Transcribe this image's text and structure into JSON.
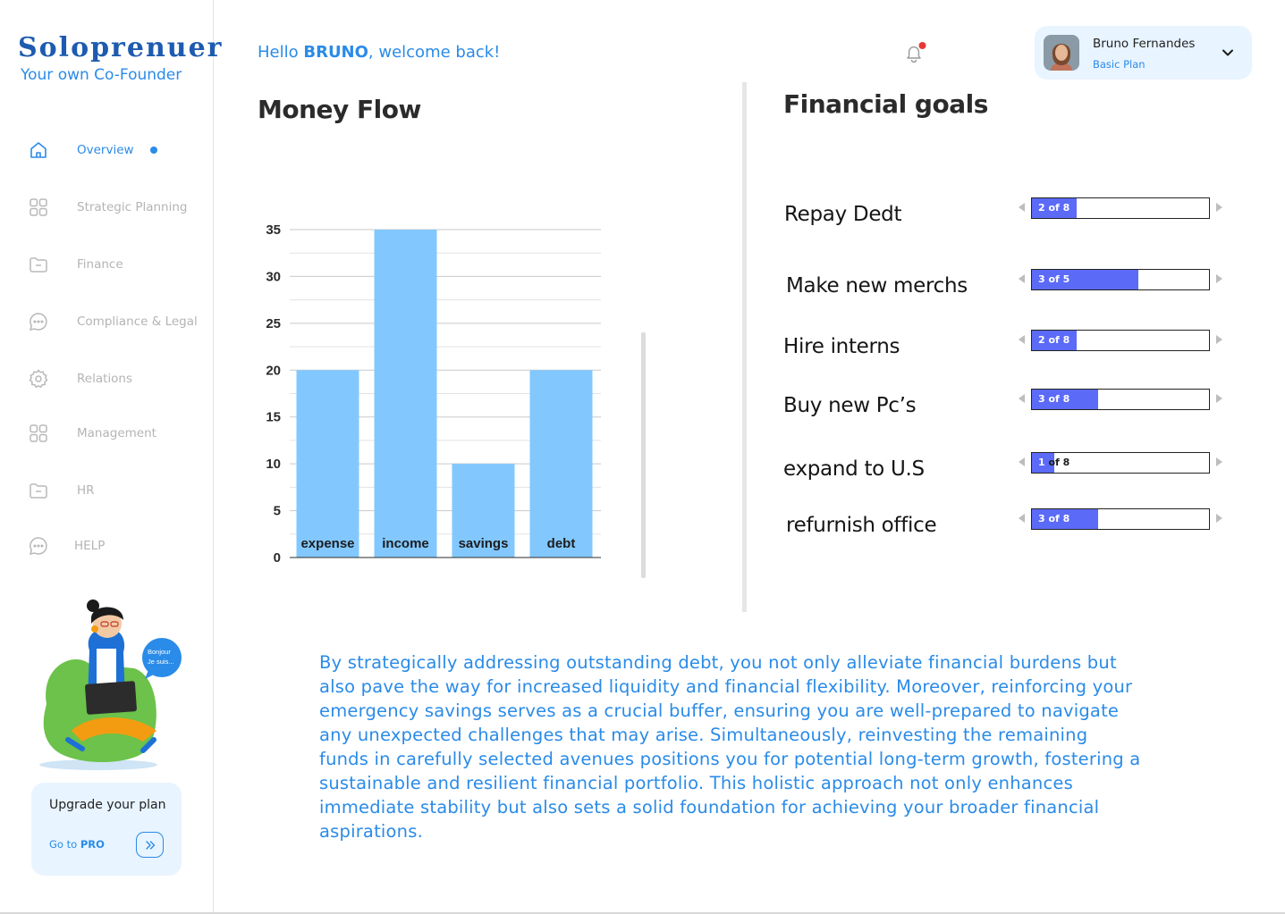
{
  "brand": {
    "name": "Soloprenuer",
    "tagline": "Your own Co-Founder"
  },
  "nav": [
    {
      "label": "Overview",
      "icon": "home-icon",
      "active": true
    },
    {
      "label": "Strategic Planning",
      "icon": "grid-icon"
    },
    {
      "label": "Finance",
      "icon": "folder-icon"
    },
    {
      "label": "Compliance & Legal",
      "icon": "chat-icon"
    },
    {
      "label": "Relations",
      "icon": "gear-icon"
    },
    {
      "label": "Management",
      "icon": "grid-icon"
    },
    {
      "label": "HR",
      "icon": "folder-icon"
    },
    {
      "label": "HELP",
      "icon": "chat-icon"
    }
  ],
  "illustration": {
    "speech": "Bonjour Je suis..."
  },
  "upgrade": {
    "title": "Upgrade your plan",
    "link_prefix": "Go to ",
    "link_bold": "PRO"
  },
  "header": {
    "greeting_prefix": "Hello ",
    "greeting_name": "BRUNO",
    "greeting_suffix": ", welcome back!"
  },
  "profile": {
    "name": "Bruno Fernandes",
    "plan": "Basic Plan"
  },
  "money_flow": {
    "title": "Money Flow"
  },
  "chart_data": {
    "type": "bar",
    "categories": [
      "expense",
      "income",
      "savings",
      "debt"
    ],
    "values": [
      20,
      35,
      10,
      20
    ],
    "title": "",
    "xlabel": "",
    "ylabel": "",
    "ylim": [
      0,
      35
    ],
    "yticks": [
      0,
      5,
      10,
      15,
      20,
      25,
      30,
      35
    ],
    "grid": true,
    "bar_color": "#82c8ff"
  },
  "financial_goals": {
    "title": "Financial goals",
    "items": [
      {
        "label": "Repay Dedt",
        "progress": "2 of 8",
        "done": 2,
        "total": 8
      },
      {
        "label": "Make new merchs",
        "progress": "3 of 5",
        "done": 3,
        "total": 5
      },
      {
        "label": "Hire interns",
        "progress": "2 of 8",
        "done": 2,
        "total": 8
      },
      {
        "label": "Buy new Pc’s",
        "progress": "3 of 8",
        "done": 3,
        "total": 8
      },
      {
        "label": "expand to U.S",
        "progress": "1 of 8",
        "done": 1,
        "total": 8
      },
      {
        "label": "refurnish office",
        "progress": "3 of 8",
        "done": 3,
        "total": 8
      }
    ]
  },
  "summary": "By strategically addressing outstanding debt, you not only alleviate financial burdens but also pave the way for increased liquidity and financial flexibility. Moreover, reinforcing your emergency savings serves as a crucial buffer, ensuring you are well-prepared to navigate any unexpected challenges that may arise. Simultaneously, reinvesting the remaining funds in carefully selected avenues positions you for potential long-term growth, fostering a sustainable and resilient financial portfolio. This holistic approach not only enhances immediate stability but also sets a solid foundation for achieving your broader financial aspirations.",
  "colors": {
    "accent": "#2a8be8",
    "brand": "#1e5bb0",
    "goal_fill": "#5b6af7",
    "bar": "#82c8ff"
  }
}
